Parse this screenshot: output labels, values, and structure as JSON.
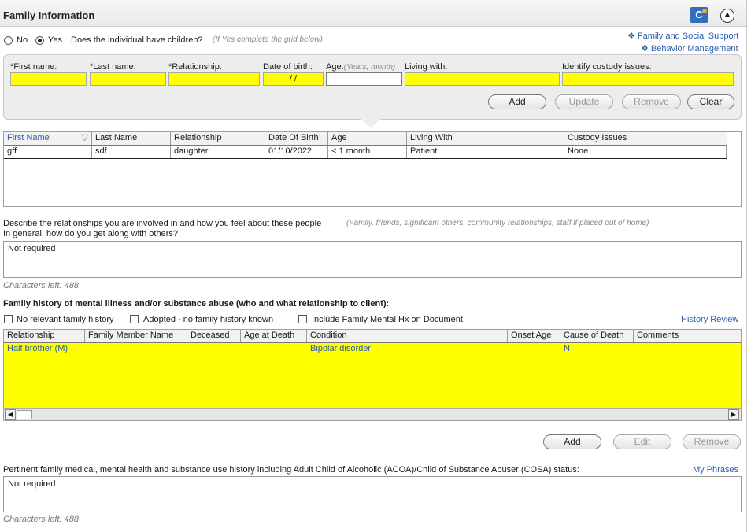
{
  "header": {
    "title": "Family Information"
  },
  "children_question": {
    "no_label": "No",
    "yes_label": "Yes",
    "selected": "Yes",
    "question": "Does the individual have children?",
    "hint": "(If Yes complete the grid below)"
  },
  "side_links": {
    "family_support": "Family and Social Support",
    "behavior": "Behavior Management"
  },
  "entry_form": {
    "first_name_label": "*First name:",
    "last_name_label": "*Last name:",
    "relationship_label": "*Relationship:",
    "dob_label": "Date of birth:",
    "dob_value": "/ /",
    "age_label": "Age:",
    "age_hint": "(Years, month)",
    "living_with_label": "Living with:",
    "custody_label": "Identify custody issues:",
    "buttons": {
      "add": "Add",
      "update": "Update",
      "remove": "Remove",
      "clear": "Clear"
    }
  },
  "children_grid": {
    "headers": [
      "First Name",
      "Last Name",
      "Relationship",
      "Date Of Birth",
      "Age",
      "Living With",
      "Custody Issues"
    ],
    "rows": [
      [
        "gff",
        "sdf",
        "daughter",
        "01/10/2022",
        "< 1 month",
        "Patient",
        "None"
      ]
    ]
  },
  "relationships": {
    "prompt": "Describe the relationships you are involved in and how you feel about these people",
    "hint": "(Family, friends, significant others, community relationships, staff if placed out of home)",
    "prompt2": "In general, how do you get along with others?",
    "value": "Not required",
    "chars_left": "Characters left: 488"
  },
  "family_history": {
    "title": "Family history of mental illness and/or substance abuse (who and what relationship to client):",
    "cb_no_history": "No relevant family history",
    "cb_adopted": "Adopted - no family history known",
    "cb_include": "Include Family Mental Hx on Document",
    "history_review": "History Review",
    "headers": [
      "Relationship",
      "Family Member Name",
      "Deceased",
      "Age at Death",
      "Condition",
      "Onset Age",
      "Cause of Death",
      "Comments"
    ],
    "rows": [
      [
        "Half brother (M)",
        "",
        "",
        "",
        "Bipolar disorder",
        "",
        "N",
        ""
      ]
    ],
    "buttons": {
      "add": "Add",
      "edit": "Edit",
      "remove": "Remove"
    }
  },
  "pertinent": {
    "prompt": "Pertinent family medical, mental health and substance use history including Adult Child of Alcoholic (ACOA)/Child of Substance Abuser (COSA) status:",
    "my_phrases": "My Phrases",
    "value": "Not required",
    "chars_left": "Characters left: 488"
  },
  "colors": {
    "required_field": "#ffff00",
    "link": "#2a5db0",
    "panel": "#ededed"
  }
}
